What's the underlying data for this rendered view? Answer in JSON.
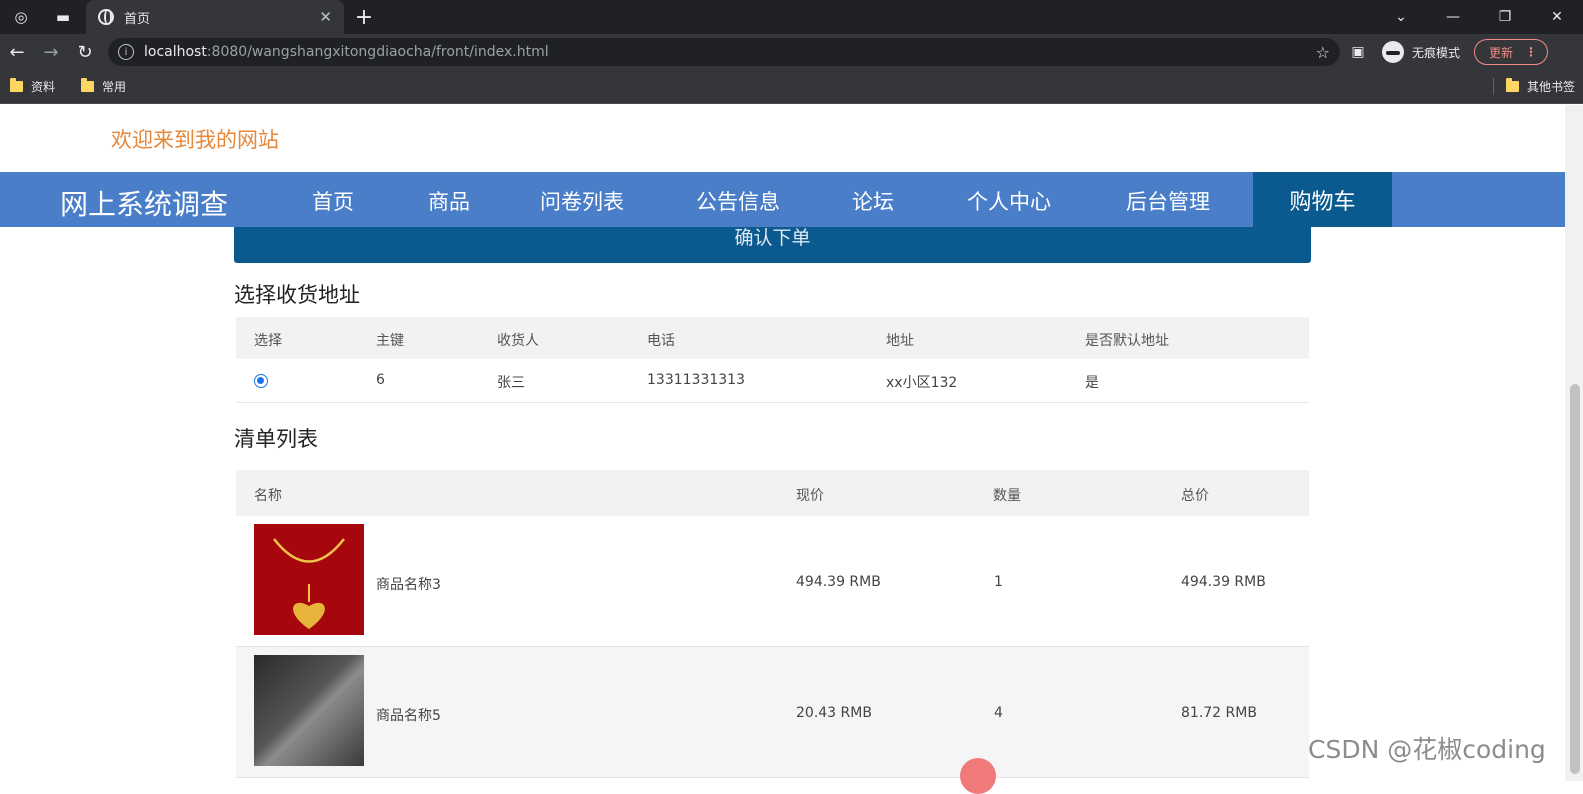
{
  "browser": {
    "tab_title": "首页",
    "url_host": "localhost",
    "url_rest": ":8080/wangshangxitongdiaocha/front/index.html",
    "incognito_label": "无痕模式",
    "update_label": "更新",
    "bookmarks": [
      "资料",
      "常用"
    ],
    "other_bookmarks": "其他书签"
  },
  "page": {
    "welcome": "欢迎来到我的网站",
    "brand": "网上系统调查",
    "nav": [
      "首页",
      "商品",
      "问卷列表",
      "公告信息",
      "论坛",
      "个人中心",
      "后台管理"
    ],
    "nav_active": "购物车",
    "confirm_button": "确认下单",
    "address_section": "选择收货地址",
    "address_headers": [
      "选择",
      "主键",
      "收货人",
      "电话",
      "地址",
      "是否默认地址"
    ],
    "address_row": {
      "id": "6",
      "name": "张三",
      "phone": "13311331313",
      "address": "xx小区132",
      "default": "是"
    },
    "list_section": "清单列表",
    "list_headers": [
      "名称",
      "现价",
      "数量",
      "总价"
    ],
    "items": [
      {
        "name": "商品名称3",
        "price": "494.39 RMB",
        "qty": "1",
        "total": "494.39 RMB"
      },
      {
        "name": "商品名称5",
        "price": "20.43 RMB",
        "qty": "4",
        "total": "81.72 RMB"
      }
    ],
    "watermark": "CSDN @花椒coding"
  }
}
